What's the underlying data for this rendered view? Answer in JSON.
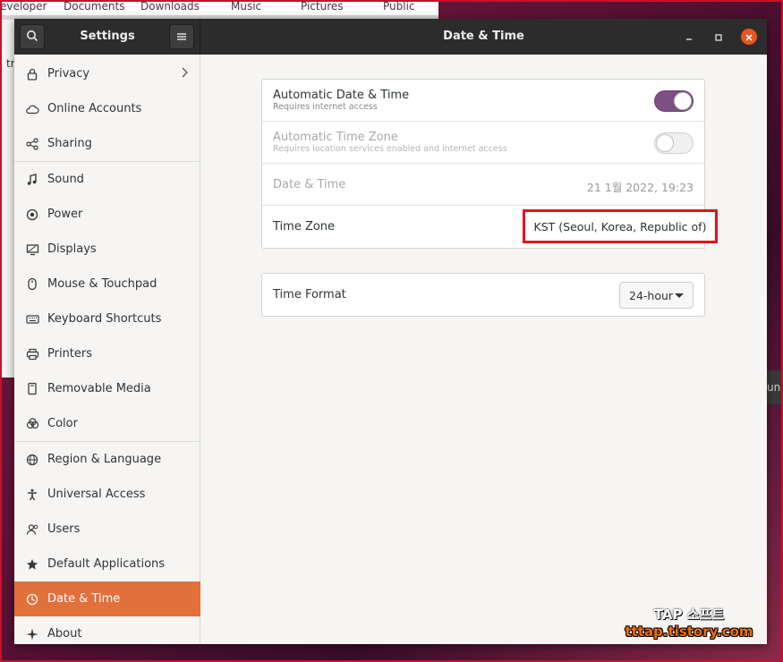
{
  "background": {
    "file_manager_places": [
      "eveloper",
      "Documents",
      "Downloads",
      "Music",
      "Pictures",
      "Public"
    ],
    "file_manager_fragment": "tr",
    "right_fragment": "un"
  },
  "header": {
    "left_title": "Settings",
    "main_title": "Date & Time"
  },
  "sidebar": {
    "items": [
      {
        "label": "Privacy",
        "icon": "lock-icon"
      },
      {
        "label": "Online Accounts",
        "icon": "cloud-icon"
      },
      {
        "label": "Sharing",
        "icon": "share-icon"
      },
      {
        "label": "Sound",
        "icon": "music-note-icon"
      },
      {
        "label": "Power",
        "icon": "power-icon"
      },
      {
        "label": "Displays",
        "icon": "display-icon"
      },
      {
        "label": "Mouse & Touchpad",
        "icon": "mouse-icon"
      },
      {
        "label": "Keyboard Shortcuts",
        "icon": "keyboard-icon"
      },
      {
        "label": "Printers",
        "icon": "printer-icon"
      },
      {
        "label": "Removable Media",
        "icon": "removable-media-icon"
      },
      {
        "label": "Color",
        "icon": "color-icon"
      },
      {
        "label": "Region & Language",
        "icon": "globe-icon"
      },
      {
        "label": "Universal Access",
        "icon": "accessibility-icon"
      },
      {
        "label": "Users",
        "icon": "users-icon"
      },
      {
        "label": "Default Applications",
        "icon": "star-icon"
      },
      {
        "label": "Date & Time",
        "icon": "clock-icon"
      },
      {
        "label": "About",
        "icon": "sparkle-icon"
      }
    ],
    "active_item": "Date & Time"
  },
  "datetime": {
    "auto_datetime": {
      "title": "Automatic Date & Time",
      "subtitle": "Requires internet access",
      "enabled": true
    },
    "auto_timezone": {
      "title": "Automatic Time Zone",
      "subtitle": "Requires location services enabled and internet access",
      "enabled": false
    },
    "date_time": {
      "title": "Date & Time",
      "value": "21 1월 2022, 19:23"
    },
    "time_zone": {
      "title": "Time Zone",
      "value": "KST (Seoul, Korea, Republic of)"
    },
    "time_format": {
      "title": "Time Format",
      "value": "24-hour"
    }
  },
  "watermark": {
    "line1": "TAP 소프트",
    "line2": "tttap.tistory.com"
  },
  "colors": {
    "accent": "#e2703b",
    "switch_on": "#7e4f83",
    "close_button": "#e95420",
    "highlight_box": "#e0141f"
  }
}
